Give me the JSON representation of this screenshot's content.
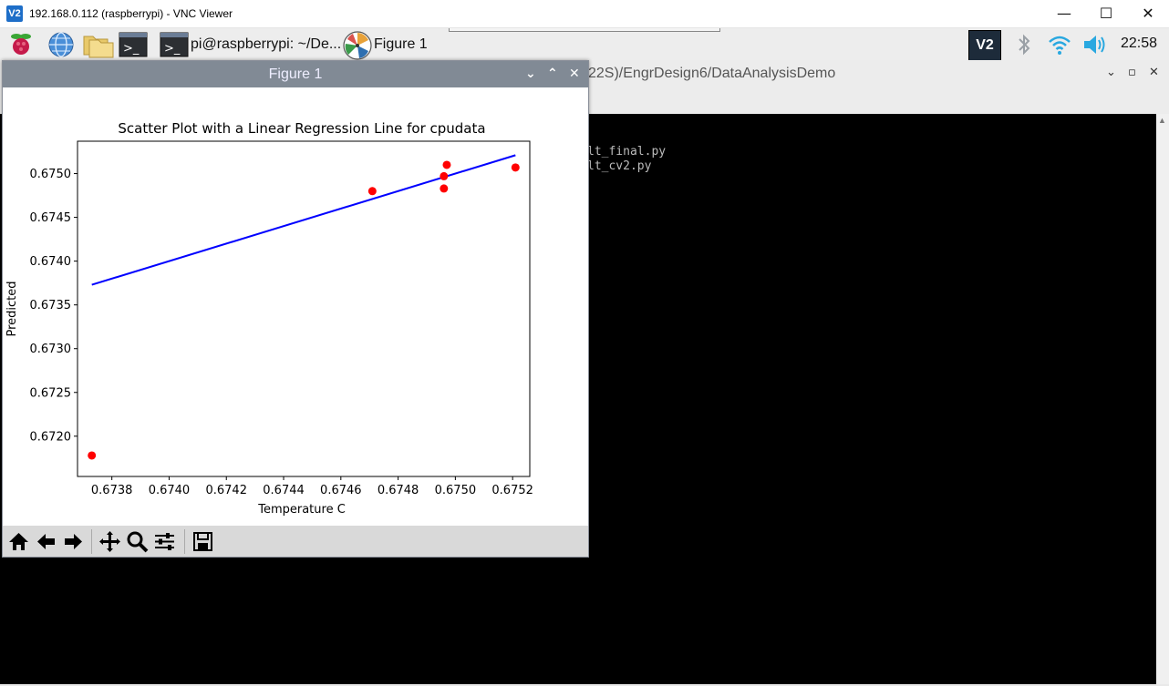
{
  "vnc_window": {
    "logo": "V2",
    "title": "192.168.0.112 (raspberrypi) - VNC Viewer",
    "minimize": "—",
    "maximize": "☐",
    "close": "✕"
  },
  "taskbar": {
    "icons": [
      "raspberry-menu-icon",
      "web-browser-icon",
      "file-manager-icon",
      "terminal-icon"
    ],
    "tasks": [
      {
        "label": "pi@raspberrypi: ~/De...",
        "icon": "terminal-icon"
      },
      {
        "label": "Figure 1",
        "icon": "matplotlib-icon"
      }
    ],
    "tray": {
      "vnc": "V2",
      "icons": [
        "bluetooth-icon",
        "wifi-icon",
        "volume-icon"
      ],
      "clock": "22:58"
    }
  },
  "terminal": {
    "title_fragment": "22S)/EngrDesign6/DataAnalysisDemo",
    "controls": [
      "⌄",
      "▫",
      "✕"
    ],
    "lines": [
      "lt_final.py",
      "lt_cv2.py"
    ],
    "background": "#000000"
  },
  "figure_window": {
    "title": "Figure 1",
    "controls": [
      "⌄",
      "⌃",
      "✕"
    ],
    "toolbar": {
      "buttons": [
        {
          "name": "home",
          "glyph": "⌂"
        },
        {
          "name": "back",
          "glyph": "←"
        },
        {
          "name": "forward",
          "glyph": "→"
        },
        {
          "name": "pan",
          "glyph": "✥"
        },
        {
          "name": "zoom",
          "glyph": "🔍"
        },
        {
          "name": "configure-subplots",
          "glyph": "☰"
        },
        {
          "name": "save",
          "glyph": "💾"
        }
      ]
    }
  },
  "chart_data": {
    "type": "scatter",
    "title": "Scatter Plot with a Linear Regression Line for cpudata",
    "xlabel": "Temperature C",
    "ylabel": "Predicted",
    "xlim": [
      0.67368,
      0.67526
    ],
    "ylim": [
      0.67154,
      0.67537
    ],
    "xticks": [
      "0.6738",
      "0.6740",
      "0.6742",
      "0.6744",
      "0.6746",
      "0.6748",
      "0.6750",
      "0.6752"
    ],
    "yticks": [
      "0.6720",
      "0.6725",
      "0.6730",
      "0.6735",
      "0.6740",
      "0.6745",
      "0.6750"
    ],
    "grid": false,
    "series": [
      {
        "kind": "points",
        "color": "#ff0000",
        "x": [
          0.67373,
          0.67471,
          0.67496,
          0.67496,
          0.67497,
          0.67521
        ],
        "y": [
          0.67178,
          0.6748,
          0.67497,
          0.67483,
          0.6751,
          0.67507
        ]
      },
      {
        "kind": "line",
        "color": "#0000ff",
        "x": [
          0.67373,
          0.67521
        ],
        "y": [
          0.67373,
          0.67521
        ]
      }
    ]
  }
}
